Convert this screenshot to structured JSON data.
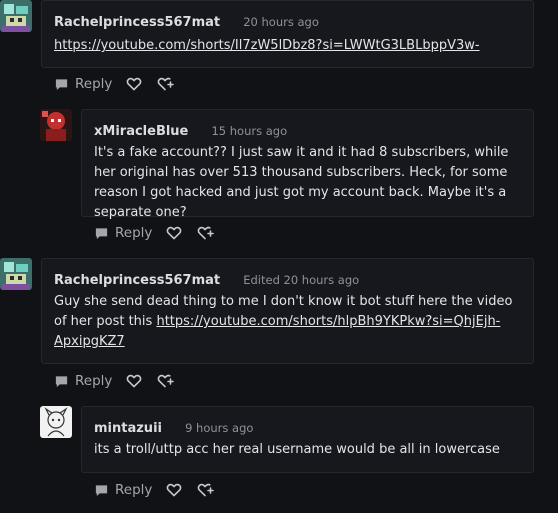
{
  "comments": [
    {
      "username": "Rachelprincess567mat",
      "time": "20 hours ago",
      "link": "https://youtube.com/shorts/Il7zW5lDbz8?si=LWWtG3LBLbppV3w-",
      "reply_label": "Reply",
      "avatar": "pixel-character-avatar"
    },
    {
      "username": "xMiracleBlue",
      "time": "15 hours ago",
      "text": "It's a fake account?? I just saw it and it had 8 subscribers, while her original has over 513 thousand subscribers. Heck, for some reason I got hacked and just got my account back. Maybe it's a separate one?",
      "reply_label": "Reply",
      "avatar": "red-character-avatar"
    },
    {
      "username": "Rachelprincess567mat",
      "time": "Edited 20 hours ago",
      "text": "Guy she send dead thing to me I don't know it bot stuff here the video of her post this ",
      "link": "https://youtube.com/shorts/hlpBh9YKPkw?si=QhjEjh-ApxipgKZ7",
      "reply_label": "Reply",
      "avatar": "pixel-character-avatar"
    },
    {
      "username": "mintazuii",
      "time": "9 hours ago",
      "text": "its a troll/uttp acc her real username would be all in lowercase",
      "reply_label": "Reply",
      "avatar": "sketch-character-avatar"
    }
  ],
  "colors": {
    "background": "#111216",
    "card": "#17181d",
    "border": "#25272e",
    "text": "#e3e5e8",
    "muted": "#8e9297"
  }
}
